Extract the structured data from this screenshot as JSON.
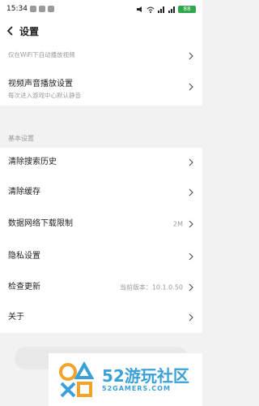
{
  "status_bar": {
    "time": "15:34",
    "battery": "88"
  },
  "header": {
    "title": "设置"
  },
  "settings": {
    "partial_item_sub": "仅在WiFi下自动播放视频",
    "video_sound": {
      "title": "视频声音播放设置",
      "sub": "每次进入游戏中心默认静音"
    },
    "section_basic": "基本设置",
    "clear_history": "清除搜索历史",
    "clear_cache": "清除缓存",
    "data_limit": {
      "title": "数据网络下载限制",
      "value": "2M"
    },
    "privacy": "隐私设置",
    "check_update": {
      "title": "检查更新",
      "value": "当前版本：10.1.0.50"
    },
    "about": "关于"
  },
  "watermark": {
    "title": "52游玩社区",
    "subtitle": "52GAMERS.COM"
  },
  "colors": {
    "accent": "#3aa0d8",
    "battery": "#2ea84a"
  }
}
